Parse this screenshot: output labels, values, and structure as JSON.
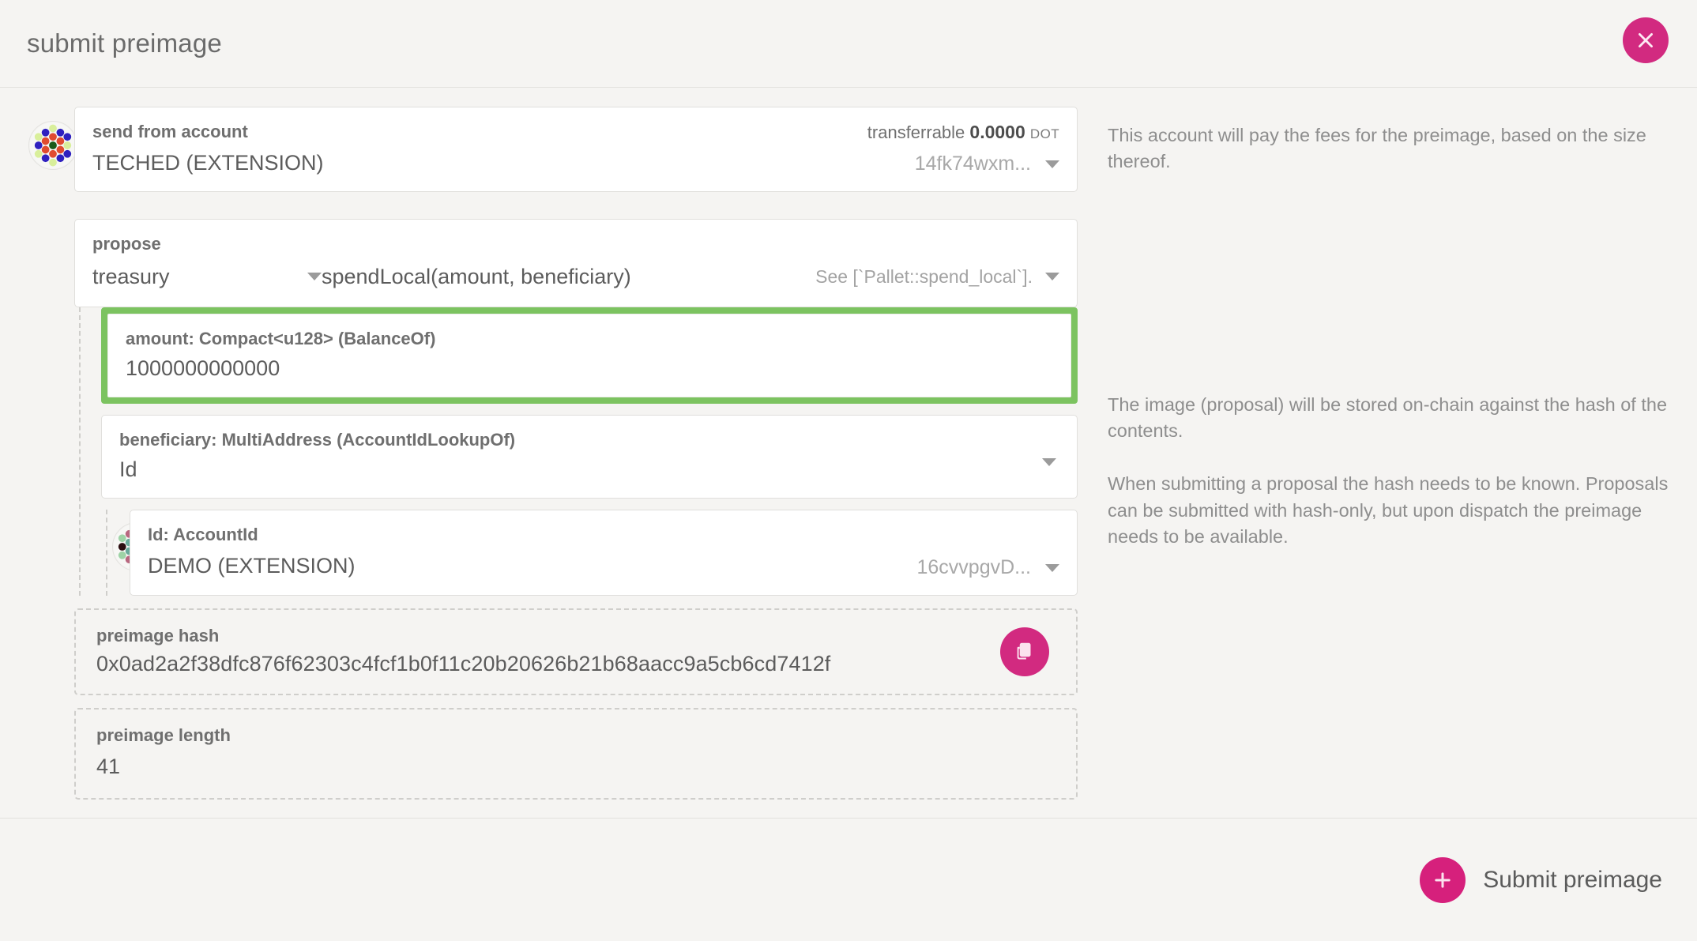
{
  "modal": {
    "title": "submit preimage",
    "close_icon": "close-icon"
  },
  "account": {
    "label": "send from account",
    "value": "TECHED (EXTENSION)",
    "transferrable_label": "transferrable",
    "transferrable_amount": "0.0000",
    "transferrable_unit": "DOT",
    "address_short": "14fk74wxm...",
    "identicon": "polkadot-identicon"
  },
  "propose": {
    "label": "propose",
    "module": "treasury",
    "function": "spendLocal(amount, beneficiary)",
    "doc": "See [`Pallet::spend_local`]."
  },
  "params": {
    "amount": {
      "label": "amount: Compact<u128> (BalanceOf)",
      "value": "1000000000000",
      "highlight_color": "#7cc360"
    },
    "beneficiary": {
      "label": "beneficiary: MultiAddress (AccountIdLookupOf)",
      "value": "Id"
    },
    "id": {
      "label": "Id: AccountId",
      "value": "DEMO (EXTENSION)",
      "address_short": "16cvvpgvD...",
      "identicon": "polkadot-identicon"
    }
  },
  "preimage": {
    "hash_label": "preimage hash",
    "hash_value": "0x0ad2a2f38dfc876f62303c4fcf1b0f11c20b20626b21b68aacc9a5cb6cd7412f",
    "copy_icon": "copy-icon",
    "length_label": "preimage length",
    "length_value": "41"
  },
  "help": {
    "account": "This account will pay the fees for the preimage, based on the size thereof.",
    "image_stored": "The image (proposal) will be stored on-chain against the hash of the contents.",
    "hash_known": "When submitting a proposal the hash needs to be known. Proposals can be submitted with hash-only, but upon dispatch the preimage needs to be available."
  },
  "footer": {
    "submit_label": "Submit preimage",
    "submit_icon": "plus-icon"
  },
  "colors": {
    "brand_pink": "#d22a80",
    "highlight_green": "#7cc360",
    "background": "#f5f4f2"
  }
}
